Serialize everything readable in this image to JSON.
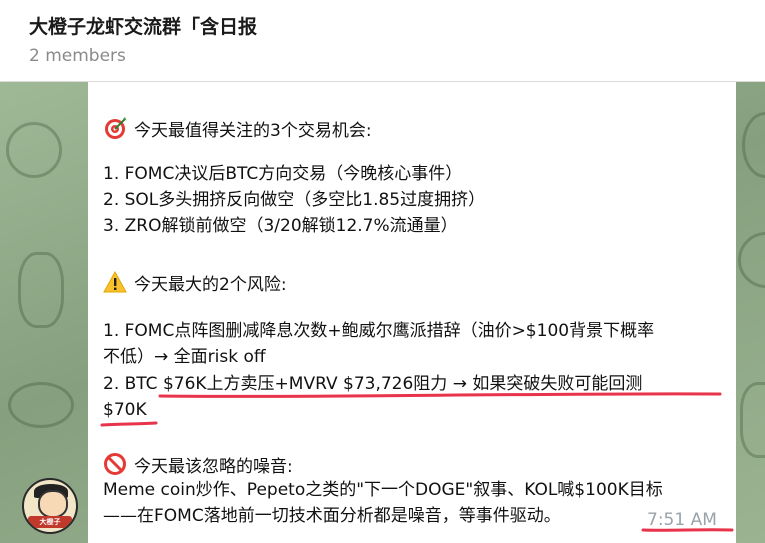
{
  "header": {
    "title": "大橙子龙虾交流群「含日报",
    "subtitle": "2 members"
  },
  "message": {
    "section1_title": "今天最值得关注的3个交易机会:",
    "section1_items": [
      "1. FOMC决议后BTC方向交易（今晚核心事件）",
      "2. SOL多头拥挤反向做空（多空比1.85过度拥挤）",
      "3. ZRO解锁前做空（3/20解锁12.7%流通量）"
    ],
    "section2_title": "今天最大的2个风险:",
    "section2_items": [
      "1. FOMC点阵图删减降息次数+鲍威尔鹰派措辞（油价>$100背景下概率",
      "不低）→ 全面risk off",
      "2. BTC $76K上方卖压+MVRV $73,726阻力 → 如果突破失败可能回测",
      "$70K"
    ],
    "section3_title": "今天最该忽略的噪音:",
    "section3_items": [
      "Meme coin炒作、Pepeto之类的\"下一个DOGE\"叙事、KOL喊$100K目标",
      "——在FOMC落地前一切技术面分析都是噪音，等事件驱动。"
    ],
    "time": "7:51 AM"
  },
  "avatar": {
    "label": "大橙子"
  },
  "icons": {
    "section1": "dart-target-icon",
    "section2": "warning-icon",
    "section3": "prohibited-icon"
  },
  "colors": {
    "annotation_red": "#e8344a",
    "wallpaper": "#8fa888"
  }
}
